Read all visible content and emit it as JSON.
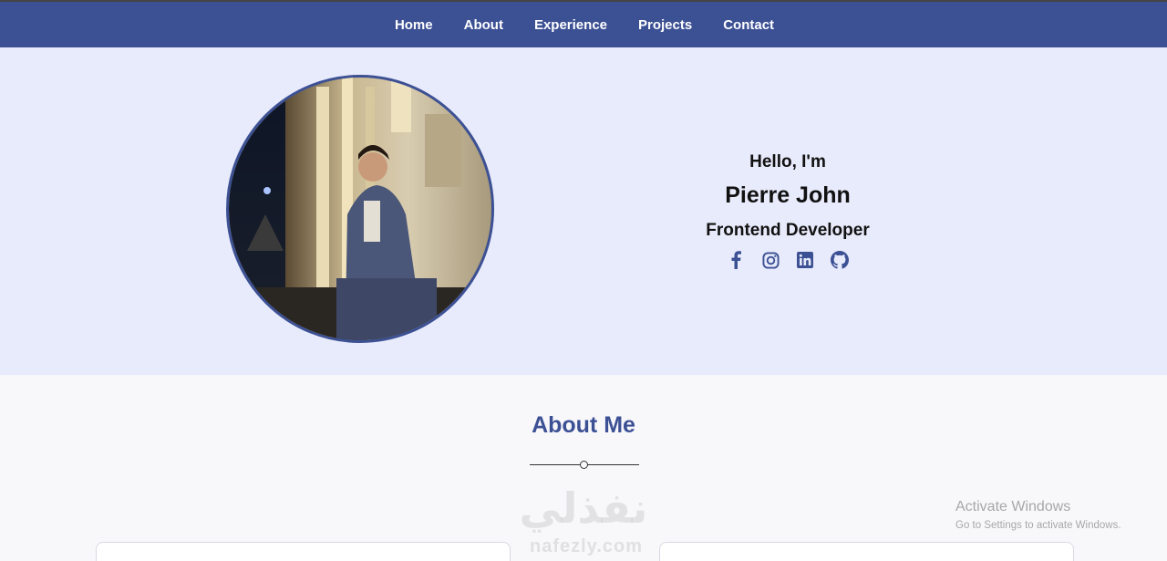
{
  "nav": {
    "links": [
      "Home",
      "About",
      "Experience",
      "Projects",
      "Contact"
    ]
  },
  "hero": {
    "greeting": "Hello, I'm",
    "name": "Pierre John",
    "role": "Frontend Developer",
    "socials": [
      "facebook-icon",
      "instagram-icon",
      "linkedin-icon",
      "github-icon"
    ]
  },
  "about": {
    "title": "About Me"
  },
  "watermark": {
    "arabic": "نفذلي",
    "latin": "nafezly.com"
  },
  "os_notice": {
    "title": "Activate Windows",
    "subtitle": "Go to Settings to activate Windows."
  },
  "colors": {
    "accent": "#3c5094",
    "hero_bg": "#e8ebfb",
    "page_bg": "#f8f8fb"
  }
}
